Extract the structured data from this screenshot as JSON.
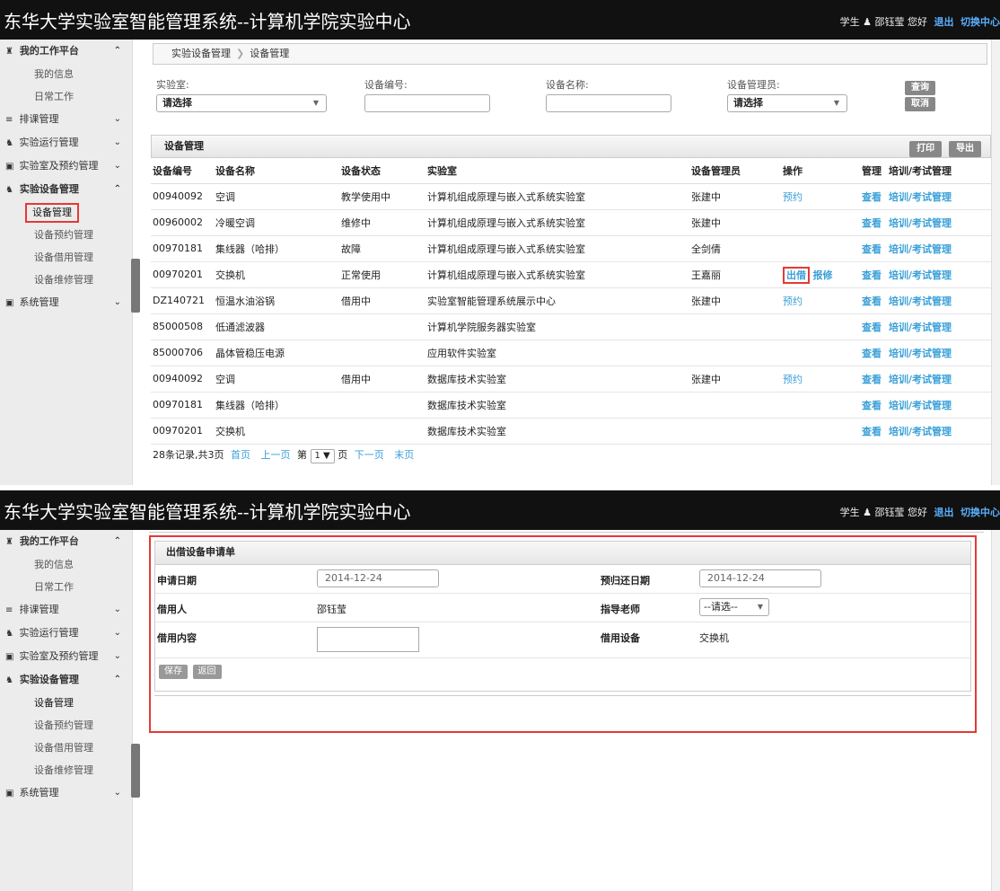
{
  "app_title": "东华大学实验室智能管理系统--计算机学院实验中心",
  "user_bar": {
    "role": "学生",
    "user_icon": "person-icon",
    "user": "邵钰莹",
    "greeting": "您好",
    "logout": "退出",
    "switch": "切换中心"
  },
  "sidebar": {
    "workbench": "我的工作平台",
    "my_info": "我的信息",
    "daily_work": "日常工作",
    "schedule": "排课管理",
    "lab_run": "实验运行管理",
    "lab_booking": "实验室及预约管理",
    "equipment": "实验设备管理",
    "eq_items1": [
      "设备管理",
      "设备预约管理",
      "设备借用管理",
      "设备维修管理"
    ],
    "system": "系统管理"
  },
  "breadcrumb": [
    "实验设备管理",
    "设备管理"
  ],
  "filters": {
    "lab_label": "实验室:",
    "lab_value": "请选择",
    "code_label": "设备编号:",
    "name_label": "设备名称:",
    "admin_label": "设备管理员:",
    "admin_value": "请选择",
    "query": "查询",
    "cancel": "取消"
  },
  "table": {
    "title": "设备管理",
    "print": "打印",
    "export": "导出",
    "headers": [
      "设备编号",
      "设备名称",
      "设备状态",
      "实验室",
      "设备管理员",
      "操作",
      "管理",
      "培训/考试管理"
    ],
    "rows": [
      {
        "code": "00940092",
        "name": "空调",
        "status": "教学使用中",
        "lab": "计算机组成原理与嵌入式系统实验室",
        "admin": "张建中",
        "op1": "预约",
        "op2": "",
        "manage": "查看",
        "train": "培训/考试管理"
      },
      {
        "code": "00960002",
        "name": "冷暖空调",
        "status": "维修中",
        "lab": "计算机组成原理与嵌入式系统实验室",
        "admin": "张建中",
        "op1": "",
        "op2": "",
        "manage": "查看",
        "train": "培训/考试管理"
      },
      {
        "code": "00970181",
        "name": "集线器（哈排）",
        "status": "故障",
        "lab": "计算机组成原理与嵌入式系统实验室",
        "admin": "全剑倩",
        "op1": "",
        "op2": "",
        "manage": "查看",
        "train": "培训/考试管理"
      },
      {
        "code": "00970201",
        "name": "交换机",
        "status": "正常使用",
        "lab": "计算机组成原理与嵌入式系统实验室",
        "admin": "王嘉丽",
        "op1": "出借",
        "op2": "报修",
        "manage": "查看",
        "train": "培训/考试管理"
      },
      {
        "code": "DZ140721",
        "name": "恒温水油浴锅",
        "status": "借用中",
        "lab": "实验室智能管理系统展示中心",
        "admin": "张建中",
        "op1": "预约",
        "op2": "",
        "manage": "查看",
        "train": "培训/考试管理"
      },
      {
        "code": "85000508",
        "name": "低通滤波器",
        "status": "",
        "lab": "计算机学院服务器实验室",
        "admin": "",
        "op1": "",
        "op2": "",
        "manage": "查看",
        "train": "培训/考试管理"
      },
      {
        "code": "85000706",
        "name": "晶体管稳压电源",
        "status": "",
        "lab": "应用软件实验室",
        "admin": "",
        "op1": "",
        "op2": "",
        "manage": "查看",
        "train": "培训/考试管理"
      },
      {
        "code": "00940092",
        "name": "空调",
        "status": "借用中",
        "lab": "数据库技术实验室",
        "admin": "张建中",
        "op1": "预约",
        "op2": "",
        "manage": "查看",
        "train": "培训/考试管理"
      },
      {
        "code": "00970181",
        "name": "集线器（哈排）",
        "status": "",
        "lab": "数据库技术实验室",
        "admin": "",
        "op1": "",
        "op2": "",
        "manage": "查看",
        "train": "培训/考试管理"
      },
      {
        "code": "00970201",
        "name": "交换机",
        "status": "",
        "lab": "数据库技术实验室",
        "admin": "",
        "op1": "",
        "op2": "",
        "manage": "查看",
        "train": "培训/考试管理"
      }
    ]
  },
  "pager": {
    "summary": "28条记录,共3页",
    "first": "首页",
    "prev": "上一页",
    "page_prefix": "第",
    "page_value": "1",
    "page_suffix": "页",
    "next": "下一页",
    "last": "末页"
  },
  "form": {
    "title": "出借设备申请单",
    "apply_date_label": "申请日期",
    "apply_date": "2014-12-24",
    "return_date_label": "预归还日期",
    "return_date": "2014-12-24",
    "borrower_label": "借用人",
    "borrower": "邵钰莹",
    "teacher_label": "指导老师",
    "teacher_value": "--请选--",
    "content_label": "借用内容",
    "device_label": "借用设备",
    "device": "交换机",
    "save": "保存",
    "back": "返回"
  }
}
